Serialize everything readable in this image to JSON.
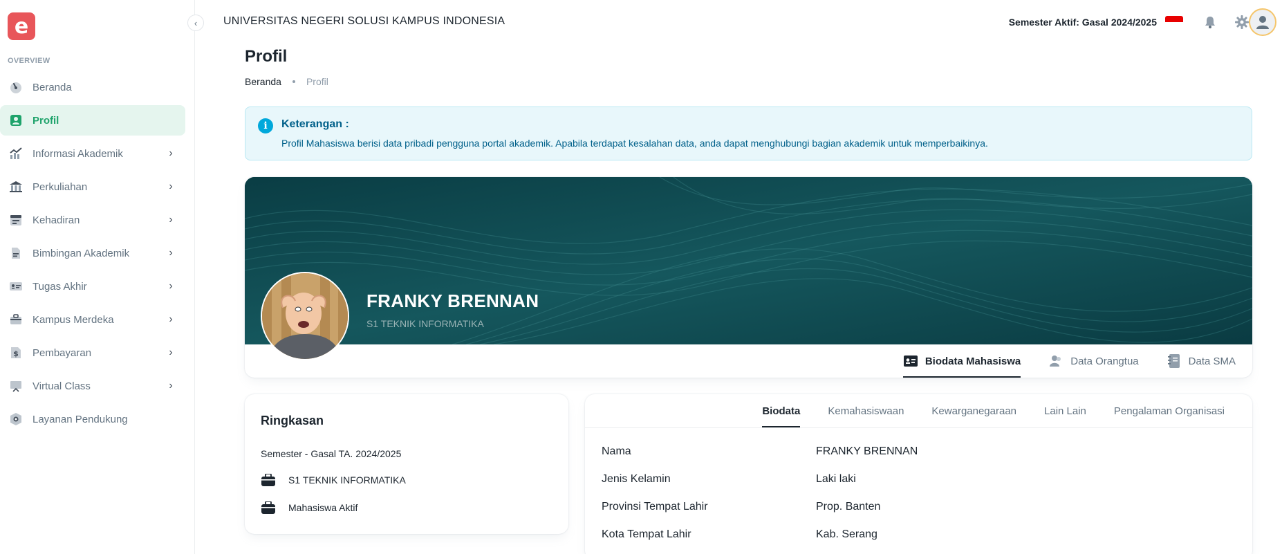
{
  "logo": {
    "letter": "e"
  },
  "sidebar": {
    "section_label": "OVERVIEW",
    "items": [
      {
        "label": "Beranda",
        "icon": "speedometer-icon",
        "active": false,
        "chevron": false
      },
      {
        "label": "Profil",
        "icon": "user-badge-icon",
        "active": true,
        "chevron": false
      },
      {
        "label": "Informasi Akademik",
        "icon": "chart-line-icon",
        "active": false,
        "chevron": true
      },
      {
        "label": "Perkuliahan",
        "icon": "bank-icon",
        "active": false,
        "chevron": true
      },
      {
        "label": "Kehadiran",
        "icon": "calendar-icon",
        "active": false,
        "chevron": true
      },
      {
        "label": "Bimbingan Akademik",
        "icon": "document-icon",
        "active": false,
        "chevron": true
      },
      {
        "label": "Tugas Akhir",
        "icon": "id-card-icon",
        "active": false,
        "chevron": true
      },
      {
        "label": "Kampus Merdeka",
        "icon": "briefcase-icon",
        "active": false,
        "chevron": true
      },
      {
        "label": "Pembayaran",
        "icon": "dollar-icon",
        "active": false,
        "chevron": true
      },
      {
        "label": "Virtual Class",
        "icon": "presentation-icon",
        "active": false,
        "chevron": true
      },
      {
        "label": "Layanan Pendukung",
        "icon": "gear-box-icon",
        "active": false,
        "chevron": false
      }
    ]
  },
  "header": {
    "university": "UNIVERSITAS NEGERI SOLUSI KAMPUS INDONESIA",
    "semester": "Semester Aktif: Gasal 2024/2025"
  },
  "page": {
    "title": "Profil",
    "breadcrumb": {
      "home": "Beranda",
      "current": "Profil"
    }
  },
  "alert": {
    "title": "Keterangan :",
    "text": "Profil Mahasiswa berisi data pribadi pengguna portal akademik. Apabila terdapat kesalahan data, anda dapat menghubungi bagian akademik untuk memperbaikinya."
  },
  "profile": {
    "name": "FRANKY BRENNAN",
    "program": "S1 TEKNIK INFORMATIKA",
    "tabs": [
      {
        "label": "Biodata Mahasiswa",
        "icon": "id-card-icon",
        "active": true
      },
      {
        "label": "Data Orangtua",
        "icon": "users-icon",
        "active": false
      },
      {
        "label": "Data SMA",
        "icon": "notebook-icon",
        "active": false
      }
    ]
  },
  "summary": {
    "title": "Ringkasan",
    "semester": "Semester - Gasal TA. 2024/2025",
    "program": "S1 TEKNIK INFORMATIKA",
    "status": "Mahasiswa Aktif"
  },
  "biodata": {
    "tabs": [
      {
        "label": "Biodata",
        "active": true
      },
      {
        "label": "Kemahasiswaan",
        "active": false
      },
      {
        "label": "Kewarganegaraan",
        "active": false
      },
      {
        "label": "Lain Lain",
        "active": false
      },
      {
        "label": "Pengalaman Organisasi",
        "active": false
      }
    ],
    "rows": [
      {
        "key": "Nama",
        "value": "FRANKY BRENNAN"
      },
      {
        "key": "Jenis Kelamin",
        "value": "Laki laki"
      },
      {
        "key": "Provinsi Tempat Lahir",
        "value": "Prop. Banten"
      },
      {
        "key": "Kota Tempat Lahir",
        "value": "Kab. Serang"
      }
    ]
  },
  "colors": {
    "accent": "#1ea36b",
    "active_bg": "#e5f5ee",
    "alert_text": "#00608a",
    "cover": "#0d4b52",
    "logo": "#e8565a"
  }
}
